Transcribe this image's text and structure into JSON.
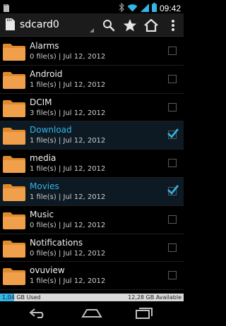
{
  "status_bar": {
    "time": "09:42"
  },
  "action_bar": {
    "title": "sdcard0",
    "icons": [
      "sdcard-icon",
      "search-icon",
      "star-icon",
      "home-icon",
      "overflow-menu-icon"
    ]
  },
  "folders": [
    {
      "name": "Alarms",
      "meta": "0 file(s) | Jul 12, 2012",
      "checked": false
    },
    {
      "name": "Android",
      "meta": "1 file(s) | Jul 12, 2012",
      "checked": false
    },
    {
      "name": "DCIM",
      "meta": "3 file(s) | Jul 12, 2012",
      "checked": false
    },
    {
      "name": "Download",
      "meta": "1 file(s) | Jul 12, 2012",
      "checked": true
    },
    {
      "name": "media",
      "meta": "1 file(s) | Jul 12, 2012",
      "checked": false
    },
    {
      "name": "Movies",
      "meta": "1 file(s) | Jul 12, 2012",
      "checked": true
    },
    {
      "name": "Music",
      "meta": "0 file(s) | Jul 12, 2012",
      "checked": false
    },
    {
      "name": "Notifications",
      "meta": "0 file(s) | Jul 12, 2012",
      "checked": false
    },
    {
      "name": "ovuview",
      "meta": "1 file(s) | Jul 12, 2012",
      "checked": false
    }
  ],
  "storage": {
    "used_label": "1,04 GB Used",
    "available_label": "12,28 GB Available",
    "used_fraction": 0.078
  },
  "colors": {
    "accent": "#33b5e5",
    "folder": "#f0a04b"
  }
}
